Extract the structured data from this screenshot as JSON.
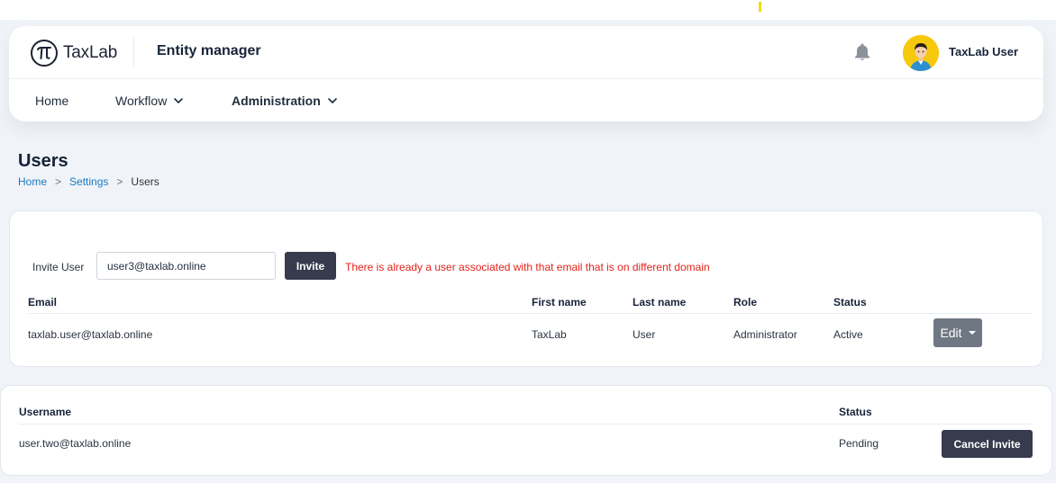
{
  "header": {
    "logo_text": "TaxLab",
    "app_title": "Entity manager",
    "user_name": "TaxLab User"
  },
  "nav": {
    "items": [
      {
        "label": "Home"
      },
      {
        "label": "Workflow"
      },
      {
        "label": "Administration"
      }
    ]
  },
  "page": {
    "title": "Users",
    "breadcrumb": [
      "Home",
      "Settings",
      "Users"
    ],
    "breadcrumb_sep": ">"
  },
  "invite": {
    "label": "Invite User",
    "input_value": "user3@taxlab.online",
    "button_label": "Invite",
    "error_message": "There is already a user associated with that email that is on different domain"
  },
  "users_table": {
    "columns": [
      "Email",
      "First name",
      "Last name",
      "Role",
      "Status"
    ],
    "rows": [
      {
        "email": "taxlab.user@taxlab.online",
        "first_name": "TaxLab",
        "last_name": "User",
        "role": "Administrator",
        "status": "Active",
        "action_label": "Edit"
      }
    ]
  },
  "invites_table": {
    "columns": [
      "Username",
      "Status"
    ],
    "rows": [
      {
        "username": "user.two@taxlab.online",
        "status": "Pending",
        "action_label": "Cancel Invite"
      }
    ]
  },
  "colors": {
    "accent_dark": "#363c4d",
    "link": "#1a7ac4",
    "error": "#e3231b",
    "avatar_bg": "#f6c90e"
  },
  "icons": [
    "pi-logo-icon",
    "bell-icon",
    "user-avatar",
    "chevron-down-icon",
    "caret-down-icon"
  ]
}
